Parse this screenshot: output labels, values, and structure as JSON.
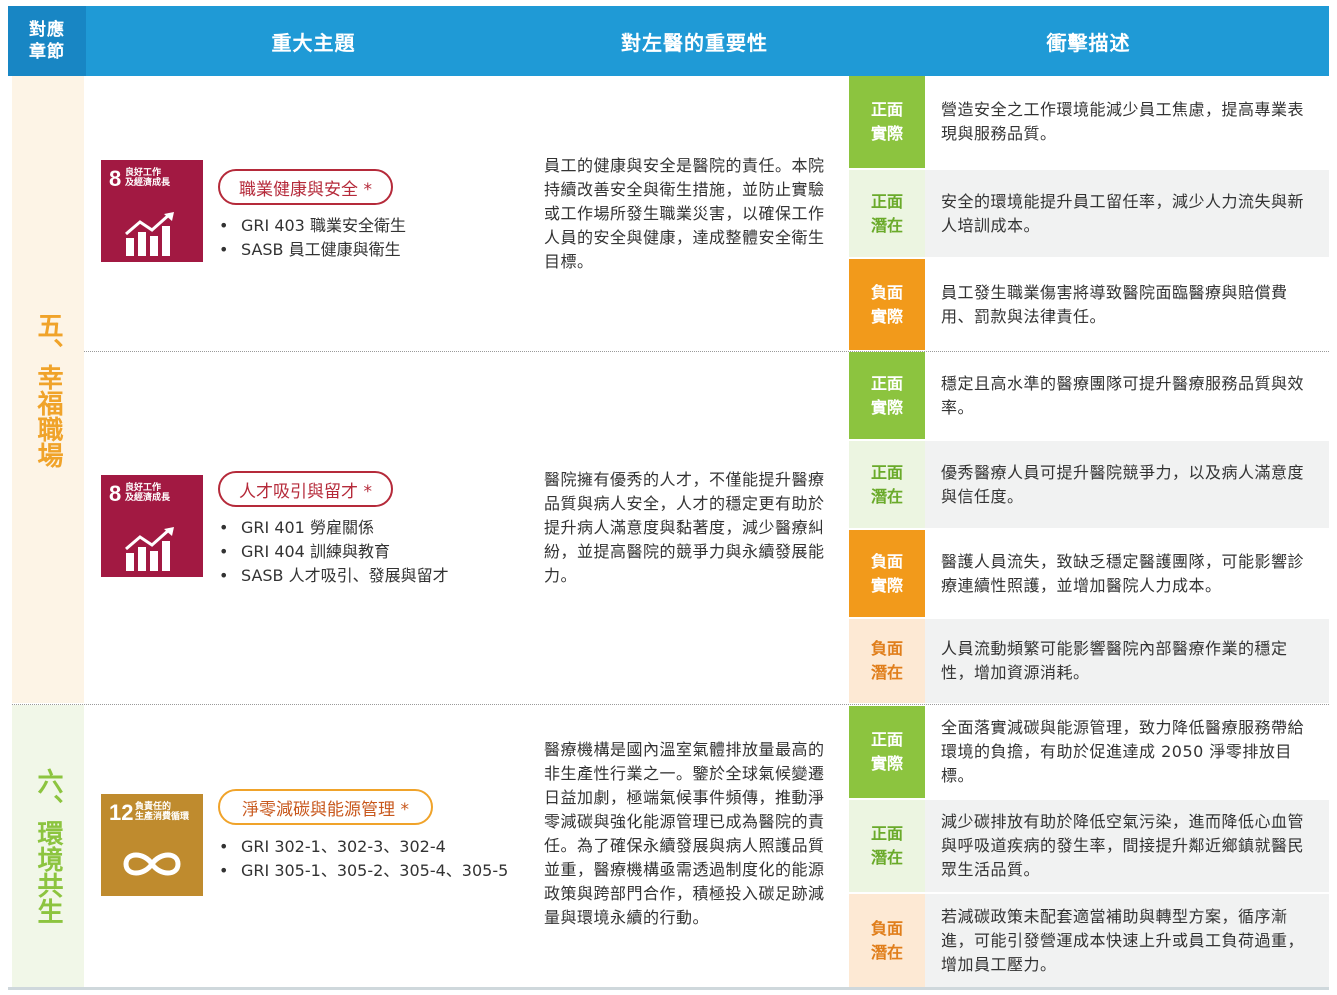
{
  "header": {
    "chapter_line1": "對應",
    "chapter_line2": "章節",
    "topic": "重大主題",
    "importance": "對左醫的重要性",
    "impact": "衝擊描述"
  },
  "chapters": {
    "five": "五、幸福職場",
    "six": "六、環境共生"
  },
  "topics": [
    {
      "sdg_number": "8",
      "sdg_text_1": "良好工作",
      "sdg_text_2": "及經濟成長",
      "sdg_color": "#a21942",
      "name": "職業健康與安全 *",
      "gri": [
        "GRI 403 職業安全衛生",
        "SASB 員工健康與衛生"
      ],
      "importance": "員工的健康與安全是醫院的責任。本院持續改善安全與衛生措施，並防止實驗或工作場所發生職業災害，以確保工作人員的安全與健康，達成整體安全衛生目標。"
    },
    {
      "sdg_number": "8",
      "sdg_text_1": "良好工作",
      "sdg_text_2": "及經濟成長",
      "sdg_color": "#a21942",
      "name": "人才吸引與留才 *",
      "gri": [
        "GRI 401 勞雇關係",
        "GRI 404 訓練與教育",
        "SASB 人才吸引、發展與留才"
      ],
      "importance": "醫院擁有優秀的人才，不僅能提升醫療品質與病人安全，人才的穩定更有助於提升病人滿意度與黏著度，減少醫療糾紛，並提高醫院的競爭力與永續發展能力。"
    },
    {
      "sdg_number": "12",
      "sdg_text_1": "負責任的",
      "sdg_text_2": "生產消費循環",
      "sdg_color": "#bf8b2e",
      "name": "淨零減碳與能源管理 *",
      "gri": [
        "GRI 302-1、302-3、302-4",
        "GRI 305-1、305-2、305-4、305-5"
      ],
      "importance": "醫療機構是國內溫室氣體排放量最高的非生產性行業之一。鑒於全球氣候變遷日益加劇，極端氣候事件頻傳，推動淨零減碳與強化能源管理已成為醫院的責任。為了確保永續發展與病人照護品質並重，醫療機構亟需透過制度化的能源政策與跨部門合作，積極投入碳足跡減量與環境永續的行動。"
    }
  ],
  "impacts": [
    {
      "tag1": "正面",
      "tag2": "實際",
      "desc": "營造安全之工作環境能減少員工焦慮，提高專業表現與服務品質。"
    },
    {
      "tag1": "正面",
      "tag2": "潛在",
      "desc": "安全的環境能提升員工留任率，減少人力流失與新人培訓成本。"
    },
    {
      "tag1": "負面",
      "tag2": "實際",
      "desc": "員工發生職業傷害將導致醫院面臨醫療與賠償費用、罰款與法律責任。"
    },
    {
      "tag1": "正面",
      "tag2": "實際",
      "desc": "穩定且高水準的醫療團隊可提升醫療服務品質與效率。"
    },
    {
      "tag1": "正面",
      "tag2": "潛在",
      "desc": "優秀醫療人員可提升醫院競爭力，以及病人滿意度與信任度。"
    },
    {
      "tag1": "負面",
      "tag2": "實際",
      "desc": "醫護人員流失，致缺乏穩定醫護團隊，可能影響診療連續性照護，並增加醫院人力成本。"
    },
    {
      "tag1": "負面",
      "tag2": "潛在",
      "desc": "人員流動頻繁可能影響醫院內部醫療作業的穩定性，增加資源消耗。"
    },
    {
      "tag1": "正面",
      "tag2": "實際",
      "desc": "全面落實減碳與能源管理，致力降低醫療服務帶給環境的負擔，有助於促進達成 2050 淨零排放目標。"
    },
    {
      "tag1": "正面",
      "tag2": "潛在",
      "desc": "減少碳排放有助於降低空氣污染，進而降低心血管與呼吸道疾病的發生率，間接提升鄰近鄉鎮就醫民眾生活品質。"
    },
    {
      "tag1": "負面",
      "tag2": "潛在",
      "desc": "若減碳政策未配套適當補助與轉型方案，循序漸進，可能引發營運成本快速上升或員工負荷過重，增加員工壓力。"
    }
  ]
}
